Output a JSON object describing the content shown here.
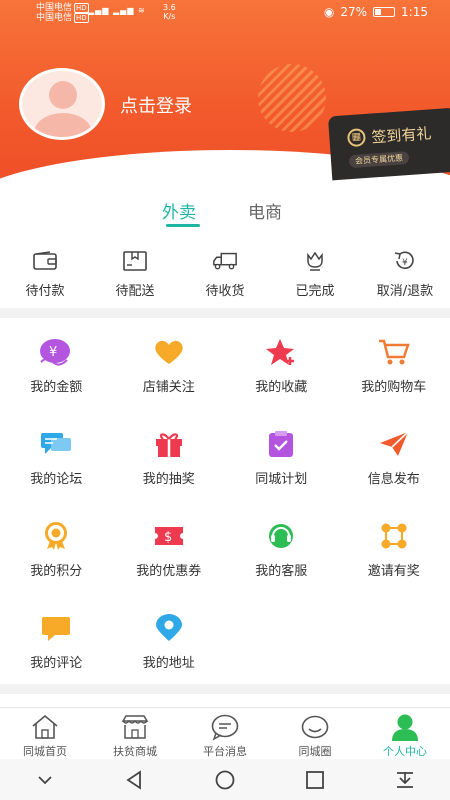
{
  "status_bar": {
    "carrier1": "中国电信",
    "carrier2": "中国电信",
    "hd": "HD",
    "speed": "3.6",
    "speed_unit": "K/s",
    "battery": "27%",
    "time": "1:15"
  },
  "header": {
    "login_text": "点击登录",
    "signin_title": "签到有礼",
    "signin_sub": "会员专属优惠"
  },
  "tabs": [
    {
      "label": "外卖"
    },
    {
      "label": "电商"
    }
  ],
  "orders": [
    {
      "label": "待付款",
      "icon": "wallet-icon"
    },
    {
      "label": "待配送",
      "icon": "package-icon"
    },
    {
      "label": "待收货",
      "icon": "truck-icon"
    },
    {
      "label": "已完成",
      "icon": "flower-icon"
    },
    {
      "label": "取消/退款",
      "icon": "refund-icon"
    }
  ],
  "grid": [
    {
      "label": "我的金额",
      "icon": "money-icon",
      "color": "#b455e0"
    },
    {
      "label": "店铺关注",
      "icon": "heart-icon",
      "color": "#f7a928"
    },
    {
      "label": "我的收藏",
      "icon": "star-icon",
      "color": "#ee3a4e"
    },
    {
      "label": "我的购物车",
      "icon": "cart-icon",
      "color": "#f07b35"
    },
    {
      "label": "我的论坛",
      "icon": "chat-icon",
      "color": "#2fa8e8"
    },
    {
      "label": "我的抽奖",
      "icon": "gift-icon",
      "color": "#ee3a4e"
    },
    {
      "label": "同城计划",
      "icon": "calendar-icon",
      "color": "#b455e0"
    },
    {
      "label": "信息发布",
      "icon": "send-icon",
      "color": "#f25a2c"
    },
    {
      "label": "我的积分",
      "icon": "medal-icon",
      "color": "#f7a928"
    },
    {
      "label": "我的优惠券",
      "icon": "coupon-icon",
      "color": "#ee3a4e"
    },
    {
      "label": "我的客服",
      "icon": "headset-icon",
      "color": "#2dbd55"
    },
    {
      "label": "邀请有奖",
      "icon": "invite-icon",
      "color": "#f7a928"
    },
    {
      "label": "我的评论",
      "icon": "comment-icon",
      "color": "#f7a928"
    },
    {
      "label": "我的地址",
      "icon": "location-icon",
      "color": "#2fa8e8"
    }
  ],
  "bottom_nav": [
    {
      "label": "同城首页",
      "icon": "home-icon"
    },
    {
      "label": "扶贫商城",
      "icon": "store-icon"
    },
    {
      "label": "平台消息",
      "icon": "message-icon"
    },
    {
      "label": "同城圈",
      "icon": "smile-icon"
    },
    {
      "label": "个人中心",
      "icon": "person-icon"
    }
  ],
  "colors": {
    "accent": "#1fb5a5",
    "header": "#f25a2c"
  }
}
